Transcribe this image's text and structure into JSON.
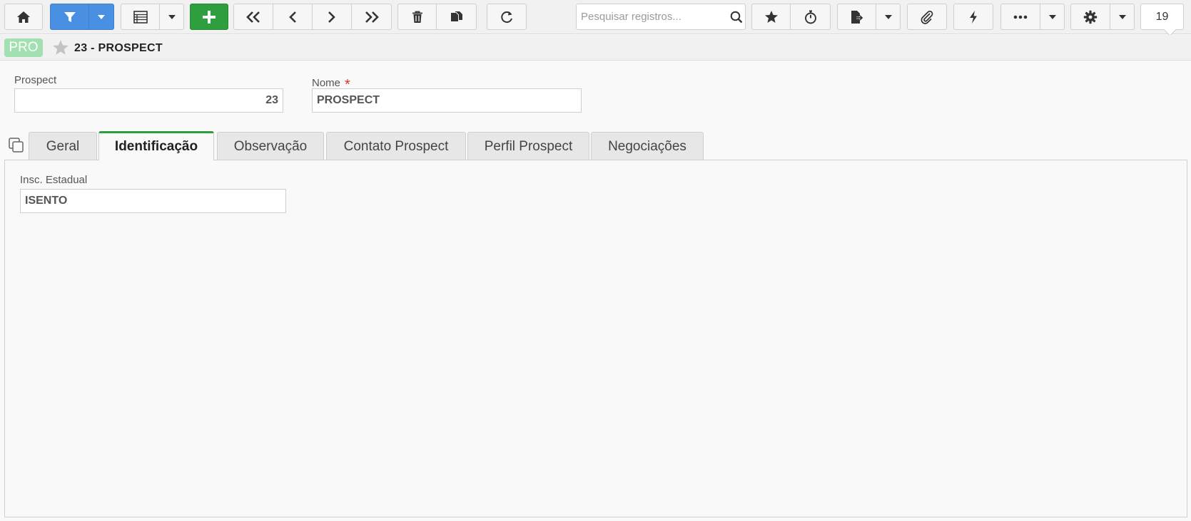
{
  "toolbar": {
    "search_placeholder": "Pesquisar registros...",
    "record_counter": "19"
  },
  "record": {
    "badge": "PRO",
    "title": "23 - PROSPECT"
  },
  "form": {
    "prospect_label": "Prospect",
    "prospect_value": "23",
    "nome_label": "Nome",
    "nome_required_mark": "*",
    "nome_value": "PROSPECT"
  },
  "tabs": [
    {
      "label": "Geral"
    },
    {
      "label": "Identificação"
    },
    {
      "label": "Observação"
    },
    {
      "label": "Contato Prospect"
    },
    {
      "label": "Perfil Prospect"
    },
    {
      "label": "Negociações"
    }
  ],
  "identificacao": {
    "insc_estadual_label": "Insc. Estadual",
    "insc_estadual_value": "ISENTO"
  },
  "colors": {
    "primary": "#4a90e2",
    "success": "#2e9e3f",
    "badge": "#a2dfb1",
    "required": "#d9342b"
  }
}
